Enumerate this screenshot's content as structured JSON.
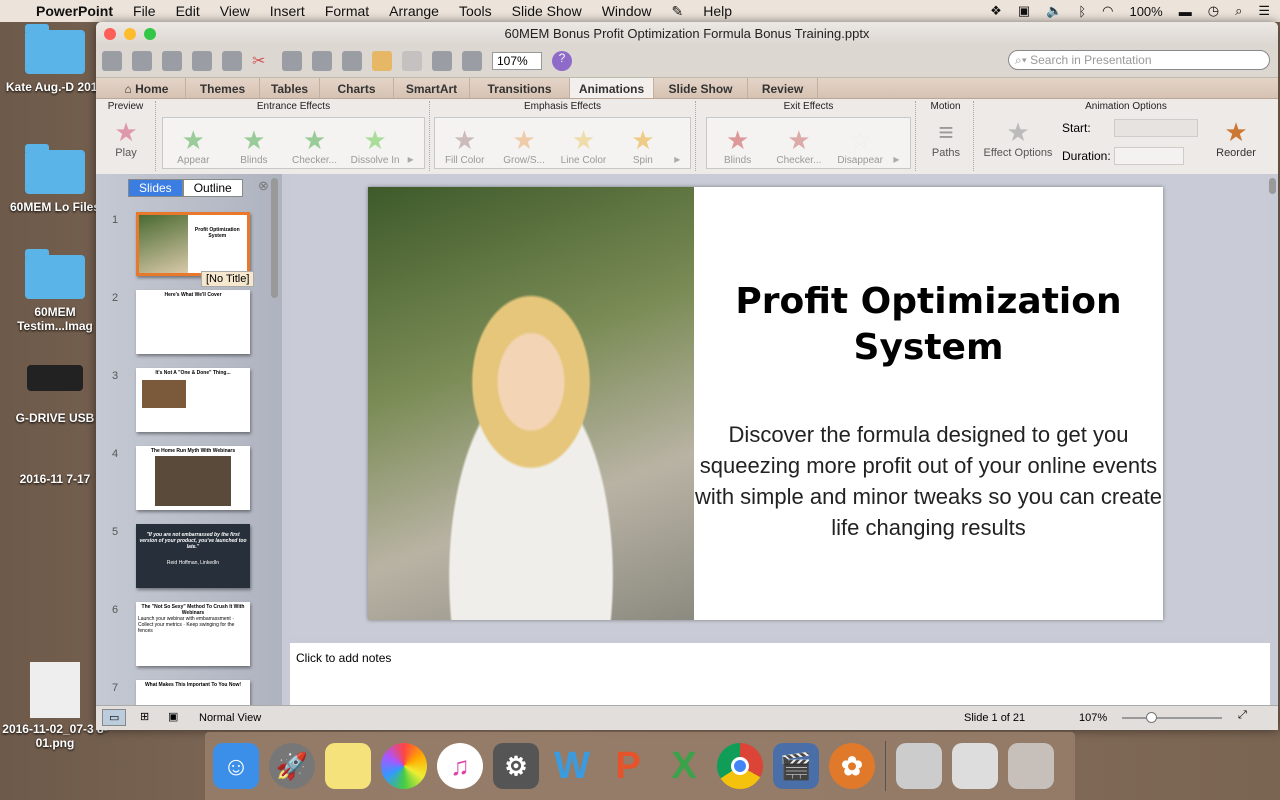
{
  "menubar": {
    "app": "PowerPoint",
    "items": [
      "File",
      "Edit",
      "View",
      "Insert",
      "Format",
      "Arrange",
      "Tools",
      "Slide Show",
      "Window",
      "Help"
    ],
    "battery": "100%"
  },
  "desktop": [
    "Kate Aug.-D 2016",
    "60MEM Lo Files",
    "60MEM Testim...Imag",
    "G-DRIVE USB",
    "2016-11 7-17",
    "2016-11-02_07-3 8-01.png"
  ],
  "window": {
    "title": "60MEM Bonus Profit Optimization Formula Bonus Training.pptx",
    "zoom": "107%",
    "search_placeholder": "Search in Presentation"
  },
  "tabs": [
    "Home",
    "Themes",
    "Tables",
    "Charts",
    "SmartArt",
    "Transitions",
    "Animations",
    "Slide Show",
    "Review"
  ],
  "ribbon": {
    "preview": "Preview",
    "play": "Play",
    "entrance": "Entrance Effects",
    "entrance_items": [
      "Appear",
      "Blinds",
      "Checker...",
      "Dissolve In"
    ],
    "emphasis": "Emphasis Effects",
    "emphasis_items": [
      "Fill Color",
      "Grow/S...",
      "Line Color",
      "Spin"
    ],
    "exit": "Exit Effects",
    "exit_items": [
      "Blinds",
      "Checker...",
      "Disappear"
    ],
    "motion": "Motion",
    "paths": "Paths",
    "options": "Animation Options",
    "effect_options": "Effect Options",
    "start": "Start:",
    "duration": "Duration:",
    "reorder": "Reorder"
  },
  "panel": {
    "slides_tab": "Slides",
    "outline_tab": "Outline",
    "tooltip": "[No Title]",
    "thumbs": [
      {
        "n": "1",
        "title": "Profit Optimization System"
      },
      {
        "n": "2",
        "title": "Here's What We'll Cover"
      },
      {
        "n": "3",
        "title": "It's Not A \"One & Done\" Thing..."
      },
      {
        "n": "4",
        "title": "The Home Run Myth With Webinars"
      },
      {
        "n": "5",
        "title": "\"If you are not embarrassed by the first version of your product, you've launched too late.\"",
        "sub": "Reid Hoffman, LinkedIn"
      },
      {
        "n": "6",
        "title": "The \"Not So Sexy\" Method To Crush It With Webinars",
        "sub": "Launch your webinar with embarrassment · Collect your metrics · Keep swinging for the fences"
      },
      {
        "n": "7",
        "title": "What Makes This Important To You Now!"
      }
    ]
  },
  "slide": {
    "title": "Profit Optimization System",
    "body": "Discover the formula designed to get you squeezing more profit out of your online events with simple and minor tweaks so you can create life changing results"
  },
  "notes": "Click to add notes",
  "statusbar": {
    "view": "Normal View",
    "slide": "Slide 1 of 21",
    "zoom": "107%"
  }
}
